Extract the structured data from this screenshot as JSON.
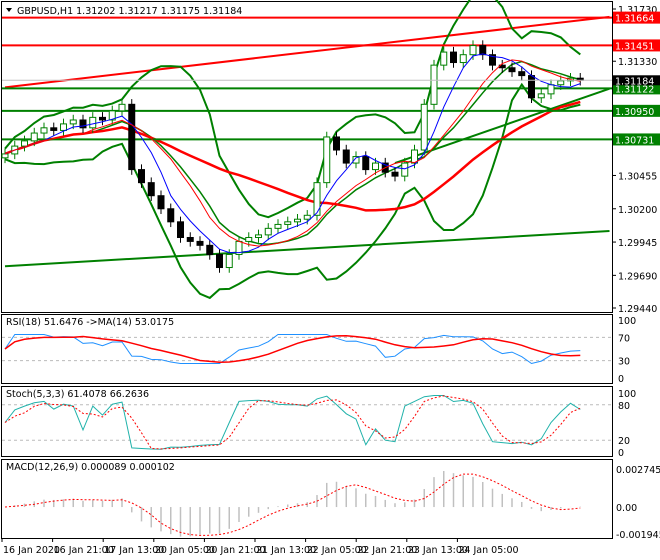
{
  "chart_data": {
    "type": "candlestick",
    "symbol": "GBPUSD",
    "timeframe": "H1",
    "header": "GBPUSD,H1  1.31202 1.31217 1.31175 1.31184",
    "ohlc_last": {
      "open": 1.31202,
      "high": 1.31217,
      "low": 1.31175,
      "close": 1.31184
    },
    "price_axis": {
      "ylim": [
        1.2944,
        1.3173
      ],
      "ticks": [
        "1.31730",
        "1.31330",
        "1.30455",
        "1.30200",
        "1.29945",
        "1.29690",
        "1.29440"
      ]
    },
    "current_price_label": "1.31184",
    "closes": [
      1.3062,
      1.3068,
      1.3072,
      1.3078,
      1.3082,
      1.308,
      1.3085,
      1.3088,
      1.3082,
      1.309,
      1.3088,
      1.3095,
      1.31,
      1.305,
      1.304,
      1.303,
      1.302,
      1.301,
      1.2998,
      1.2995,
      1.2992,
      1.2985,
      1.2975,
      1.2985,
      1.2995,
      1.2998,
      1.3,
      1.3005,
      1.3008,
      1.301,
      1.3012,
      1.3015,
      1.304,
      1.3075,
      1.3065,
      1.3055,
      1.306,
      1.305,
      1.3055,
      1.3048,
      1.3045,
      1.3055,
      1.3065,
      1.31,
      1.313,
      1.314,
      1.3132,
      1.3138,
      1.3145,
      1.3138,
      1.313,
      1.3128,
      1.3125,
      1.3122,
      1.3105,
      1.3108,
      1.3115,
      1.3118,
      1.312,
      1.31184
    ],
    "levels": [
      {
        "price": 1.31664,
        "label": "1.31664",
        "color": "#ff0000"
      },
      {
        "price": 1.31451,
        "label": "1.31451",
        "color": "#ff0000"
      },
      {
        "price": 1.31122,
        "label": "1.31122",
        "color": "#008000"
      },
      {
        "price": 1.3095,
        "label": "1.30950",
        "color": "#008000"
      },
      {
        "price": 1.30731,
        "label": "1.30731",
        "color": "#008000"
      }
    ],
    "trendlines": [
      {
        "from": [
          0,
          1.3113
        ],
        "to": [
          62,
          1.3167
        ],
        "color": "#ff0000"
      },
      {
        "from": [
          0,
          1.2976
        ],
        "to": [
          62,
          1.3003
        ],
        "color": "#008000"
      },
      {
        "from": [
          40,
          1.3055
        ],
        "to": [
          62,
          1.3112
        ],
        "color": "#008000"
      }
    ],
    "rsi": {
      "label": "RSI(18) 51.6476  ->MA(14) 53.0175",
      "ticks": [
        "100",
        "70",
        "30",
        "0"
      ],
      "levels": [
        70,
        30
      ]
    },
    "stoch": {
      "label": "Stoch(5,3,3) 61.4078 66.2636",
      "ticks": [
        "100",
        "80",
        "20",
        "0"
      ],
      "levels": [
        80,
        20
      ]
    },
    "macd": {
      "label": "MACD(12,26,9) 0.000089 0.000102",
      "ticks": [
        "0.002745",
        "0.00",
        "-0.001945"
      ],
      "range": [
        -0.001945,
        0.002745
      ]
    },
    "time_labels": [
      "16 Jan 2020",
      "16 Jan 21:00",
      "17 Jan 13:00",
      "20 Jan 05:00",
      "20 Jan 21:00",
      "21 Jan 13:00",
      "22 Jan 05:00",
      "22 Jan 21:00",
      "23 Jan 13:00",
      "24 Jan 05:00"
    ],
    "colors": {
      "bull": "#008000",
      "bear": "#000000",
      "ma_fast": "#0000ff",
      "ma_slow": "#ff0000",
      "bands": "#008000",
      "rsi": "#1e90ff",
      "stoch_main": "#20b2aa",
      "signal": "#ff0000",
      "hist": "#c0c0c0"
    }
  }
}
